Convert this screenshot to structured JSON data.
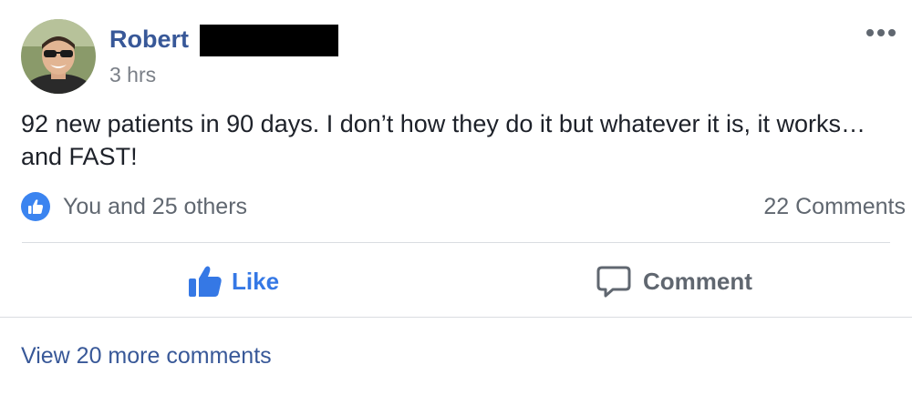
{
  "post": {
    "author": "Robert",
    "timestamp": "3 hrs",
    "text": "92 new patients in 90 days. I don’t how they do it but whatever it is, it works… and FAST!"
  },
  "reactions": {
    "summary": "You and 25 others",
    "comments_count": "22 Comments"
  },
  "actions": {
    "like_label": "Like",
    "comment_label": "Comment"
  },
  "comments": {
    "view_more": "View 20 more comments"
  },
  "icons": {
    "more": "more-options-icon",
    "like_badge": "thumbs-up-icon",
    "like_action": "thumbs-up-icon",
    "comment_action": "speech-bubble-icon"
  },
  "colors": {
    "author_link": "#385898",
    "like_blue": "#3578e5",
    "muted_text": "#606770",
    "divider": "#dadde1"
  }
}
